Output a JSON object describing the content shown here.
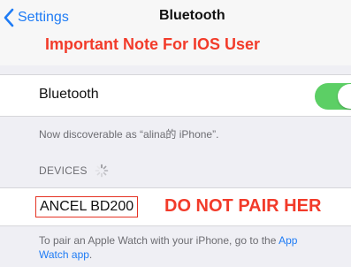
{
  "nav": {
    "back_label": "Settings",
    "title": "Bluetooth"
  },
  "annotation": {
    "note": "Important Note For IOS User",
    "warning": "DO NOT PAIR HER"
  },
  "bluetooth": {
    "label": "Bluetooth",
    "enabled": true,
    "discoverable_text": "Now discoverable as “alina的 iPhone”."
  },
  "devices": {
    "header": "DEVICES",
    "items": [
      {
        "name": "ANCEL BD200"
      }
    ]
  },
  "pair_hint": {
    "text": "To pair an Apple Watch with your iPhone, go to the ",
    "link_part1": "App",
    "link_part2": "Watch app",
    "end": "."
  },
  "colors": {
    "accent": "#1f7cf5",
    "annotation_red": "#f23b2a",
    "toggle_on": "#5ccf65"
  },
  "icons": {
    "back": "chevron-left-icon",
    "loading": "spinner-icon"
  }
}
